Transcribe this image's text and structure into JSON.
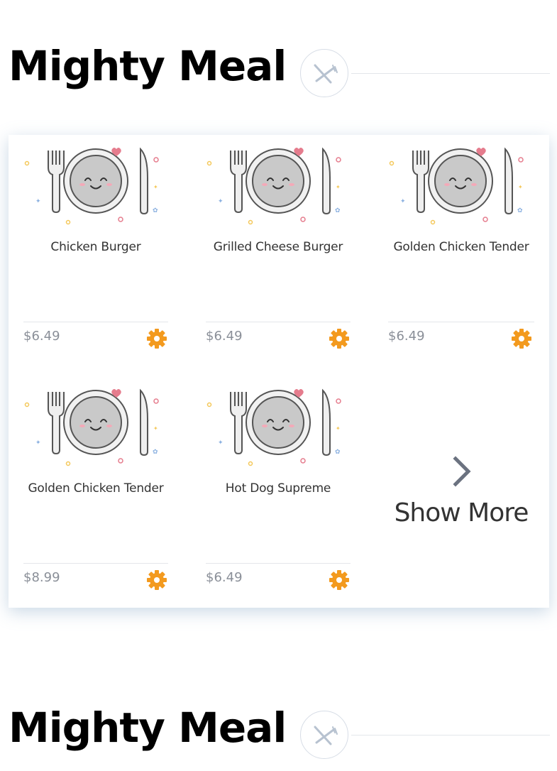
{
  "sections": [
    {
      "title": "Mighty Meal"
    },
    {
      "title": "Mighty Meal"
    }
  ],
  "colors": {
    "accent_gear": "#f39a1e",
    "price_text": "#8a8f98",
    "title_text": "#000000",
    "chevron": "#6b7280"
  },
  "icons": {
    "section_emblem": "fork-knife-crossed-icon",
    "card_action": "gear-icon",
    "show_more": "chevron-right-icon",
    "card_image": "smiling-plate-illustration"
  },
  "menu_items": [
    {
      "name": "Chicken Burger",
      "price": "$6.49"
    },
    {
      "name": "Grilled Cheese Burger",
      "price": "$6.49"
    },
    {
      "name": "Golden Chicken Tender",
      "price": "$6.49"
    },
    {
      "name": "Golden Chicken Tender",
      "price": "$8.99"
    },
    {
      "name": "Hot Dog Supreme",
      "price": "$6.49"
    }
  ],
  "show_more": {
    "label": "Show More"
  }
}
